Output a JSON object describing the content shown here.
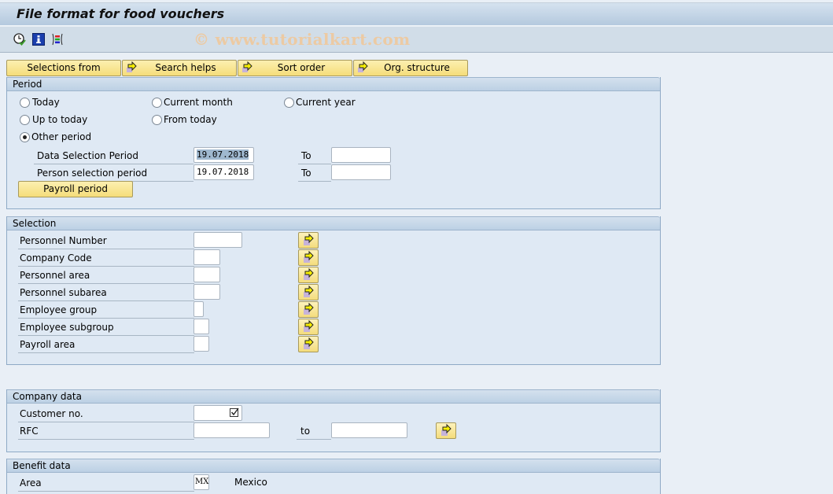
{
  "window": {
    "title": "File format for food vouchers",
    "watermark": "© www.tutorialkart.com"
  },
  "toolbar": {
    "icons": [
      "execute-clock-icon",
      "info-icon",
      "layout-icon"
    ]
  },
  "tabs": [
    {
      "label": "Selections from",
      "icon": null
    },
    {
      "label": "Search helps",
      "icon": "arrow-right-icon"
    },
    {
      "label": "Sort order",
      "icon": "arrow-right-icon"
    },
    {
      "label": "Org. structure",
      "icon": "arrow-right-icon"
    }
  ],
  "period": {
    "title": "Period",
    "radios": [
      {
        "label": "Today",
        "selected": false
      },
      {
        "label": "Current month",
        "selected": false
      },
      {
        "label": "Current year",
        "selected": false
      },
      {
        "label": "Up to today",
        "selected": false
      },
      {
        "label": "From today",
        "selected": false
      },
      {
        "label": "Other period",
        "selected": true
      }
    ],
    "data_selection": {
      "label": "Data Selection Period",
      "from": "19.07.2018",
      "to_label": "To",
      "to": ""
    },
    "person_selection": {
      "label": "Person selection period",
      "from": "19.07.2018",
      "to_label": "To",
      "to": ""
    },
    "payroll_button": "Payroll period"
  },
  "selection": {
    "title": "Selection",
    "rows": [
      {
        "label": "Personnel Number",
        "value": ""
      },
      {
        "label": "Company Code",
        "value": ""
      },
      {
        "label": "Personnel area",
        "value": ""
      },
      {
        "label": "Personnel subarea",
        "value": ""
      },
      {
        "label": "Employee group",
        "value": ""
      },
      {
        "label": "Employee subgroup",
        "value": ""
      },
      {
        "label": "Payroll area",
        "value": ""
      }
    ]
  },
  "company": {
    "title": "Company data",
    "customer_label": "Customer no.",
    "customer_value": "",
    "customer_checked": true,
    "rfc_label": "RFC",
    "rfc_from": "",
    "rfc_to_label": "to",
    "rfc_to": ""
  },
  "benefit": {
    "title": "Benefit data",
    "area_label": "Area",
    "area_value": "MX",
    "area_text": "Mexico"
  }
}
